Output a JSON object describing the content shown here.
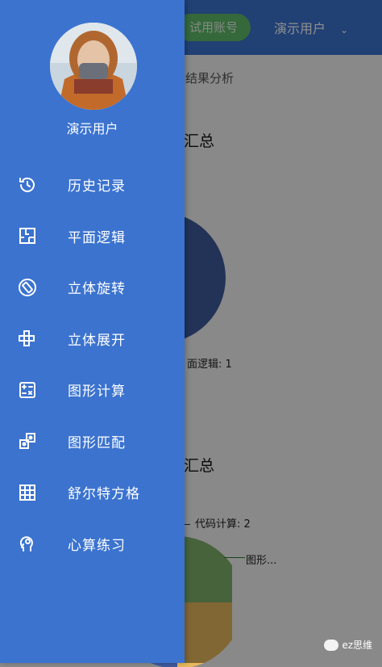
{
  "background": {
    "header": {
      "trial_button": "试用账号",
      "user_menu_label": "演示用户"
    },
    "subtitle": "结果分析",
    "section1_title": "汇总",
    "section1_pie_label": "面逻辑: 1",
    "section2_title": "汇总",
    "section2_legend_label": "代码计算: 2",
    "section2_callout": "图形..."
  },
  "drawer": {
    "username": "演示用户",
    "items": [
      {
        "label": "历史记录",
        "icon": "history-icon"
      },
      {
        "label": "平面逻辑",
        "icon": "floorplan-icon"
      },
      {
        "label": "立体旋转",
        "icon": "rotate-icon"
      },
      {
        "label": "立体展开",
        "icon": "cube-net-icon"
      },
      {
        "label": "图形计算",
        "icon": "calculator-icon"
      },
      {
        "label": "图形匹配",
        "icon": "match-icon"
      },
      {
        "label": "舒尔特方格",
        "icon": "grid-icon"
      },
      {
        "label": "心算练习",
        "icon": "head-gear-icon"
      }
    ]
  },
  "watermark": "ez思维",
  "colors": {
    "primary": "#3b73cf",
    "trial_green": "#5fba6a",
    "pie_blue": "#3f5a9c",
    "pie_green": "#7fb069",
    "pie_yellow": "#e6b85c"
  }
}
